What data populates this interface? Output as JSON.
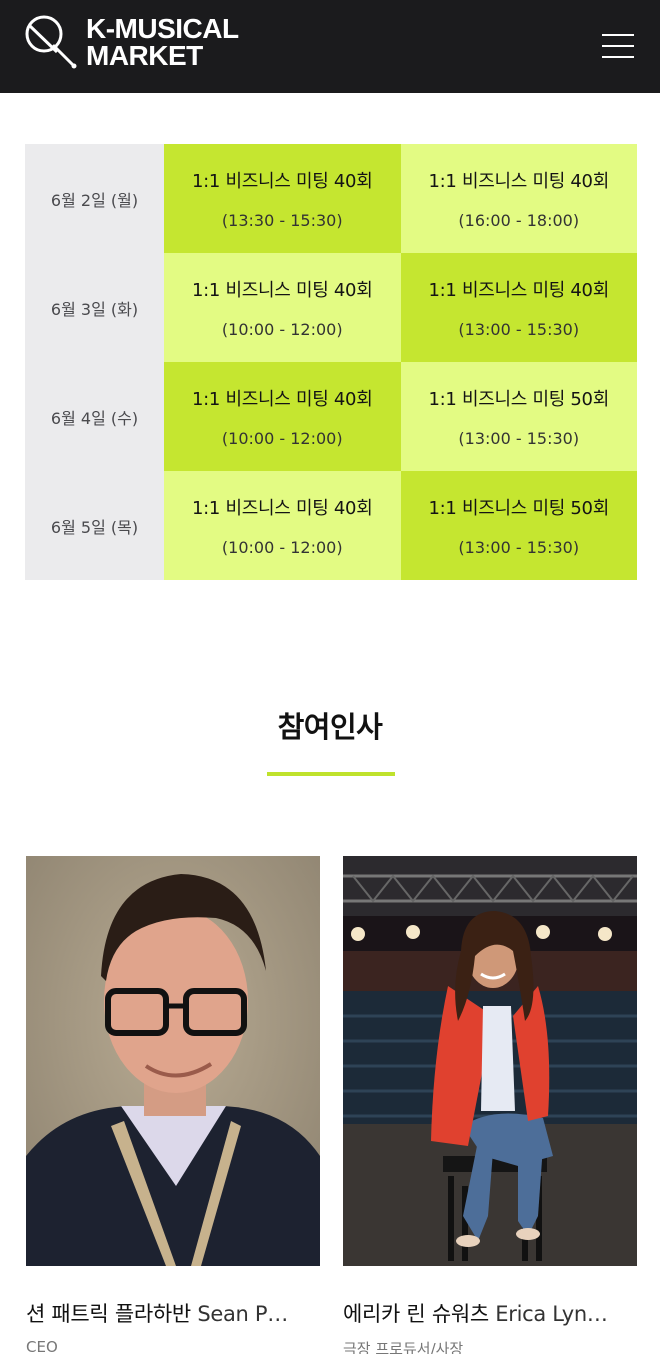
{
  "header": {
    "logo_line1": "K-MUSICAL",
    "logo_line2": "MARKET",
    "menu_icon": "hamburger-menu-icon"
  },
  "schedule": [
    {
      "date": "6월 2일 (월)",
      "sessions": [
        {
          "title": "1:1 비즈니스 미팅 40회",
          "time": "(13:30 - 15:30)",
          "shade": "dark"
        },
        {
          "title": "1:1 비즈니스 미팅 40회",
          "time": "(16:00 - 18:00)",
          "shade": "light"
        }
      ]
    },
    {
      "date": "6월 3일 (화)",
      "sessions": [
        {
          "title": "1:1 비즈니스 미팅 40회",
          "time": "(10:00 - 12:00)",
          "shade": "light"
        },
        {
          "title": "1:1 비즈니스 미팅 40회",
          "time": "(13:00 - 15:30)",
          "shade": "dark"
        }
      ]
    },
    {
      "date": "6월 4일 (수)",
      "sessions": [
        {
          "title": "1:1 비즈니스 미팅 40회",
          "time": "(10:00 - 12:00)",
          "shade": "dark"
        },
        {
          "title": "1:1 비즈니스 미팅 50회",
          "time": "(13:00 - 15:30)",
          "shade": "light"
        }
      ]
    },
    {
      "date": "6월 5일 (목)",
      "sessions": [
        {
          "title": "1:1 비즈니스 미팅 40회",
          "time": "(10:00 - 12:00)",
          "shade": "light"
        },
        {
          "title": "1:1 비즈니스 미팅 50회",
          "time": "(13:00 - 15:30)",
          "shade": "dark"
        }
      ]
    }
  ],
  "participants": {
    "title": "참여인사",
    "cards": [
      {
        "name_ko": "션 패트릭 플라하반",
        "name_en": "Sean P…",
        "subtitle": "CEO"
      },
      {
        "name_ko": "에리카 린 슈워츠",
        "name_en": "Erica Lyn…",
        "subtitle": "극장 프로듀서/사장"
      }
    ]
  },
  "colors": {
    "header_bg": "#1b1b1d",
    "accent_dark": "#c5e630",
    "accent_light": "#e3fb83",
    "date_bg": "#ebebed"
  }
}
